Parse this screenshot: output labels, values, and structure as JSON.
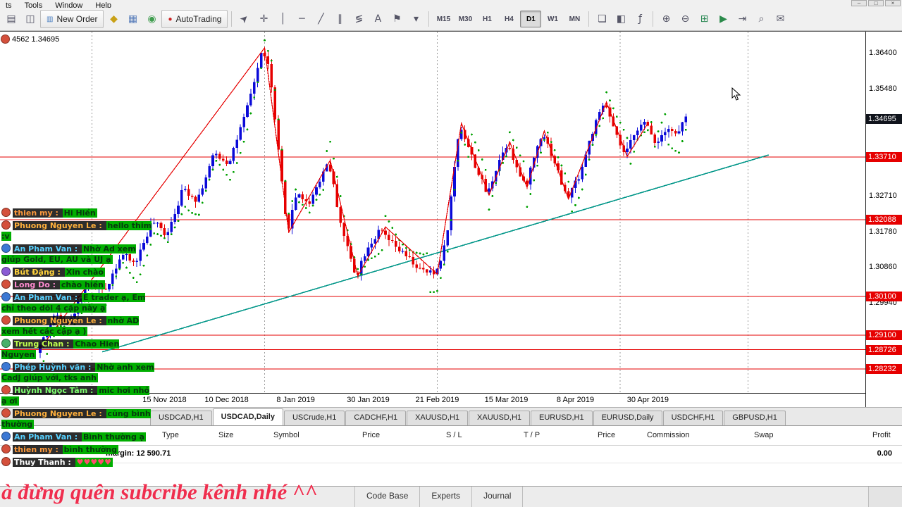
{
  "window": {
    "menu_items": [
      "ts",
      "Tools",
      "Window",
      "Help"
    ],
    "window_controls": [
      {
        "name": "minimize-button",
        "glyph": "–"
      },
      {
        "name": "restore-button",
        "glyph": "□"
      },
      {
        "name": "close-button",
        "glyph": "×"
      }
    ]
  },
  "toolbar": {
    "items": [
      {
        "type": "icon",
        "name": "new-chart-icon",
        "glyph": "▤"
      },
      {
        "type": "icon",
        "name": "profiles-icon",
        "glyph": "◫"
      },
      {
        "type": "button",
        "name": "new-order-button",
        "label": "New Order",
        "glyph": "▥",
        "glyph_color": "#4a7fc1"
      },
      {
        "type": "icon",
        "name": "expert-advisors-icon",
        "glyph": "◆",
        "color": "#c9a117"
      },
      {
        "type": "icon",
        "name": "print-icon",
        "glyph": "▦",
        "color": "#5b7fbb"
      },
      {
        "type": "icon",
        "name": "data-window-icon",
        "glyph": "◉",
        "color": "#3f9d4e"
      },
      {
        "type": "button",
        "name": "autotrading-button",
        "label": "AutoTrading",
        "glyph": "●",
        "glyph_color": "#cc2222"
      },
      {
        "type": "sep"
      },
      {
        "type": "icon",
        "name": "cursor-icon",
        "glyph": "➤",
        "rot": -45
      },
      {
        "type": "icon",
        "name": "crosshair-icon",
        "glyph": "✛"
      },
      {
        "type": "icon",
        "name": "vertical-line-icon",
        "glyph": "│"
      },
      {
        "type": "icon",
        "name": "horizontal-line-icon",
        "glyph": "─"
      },
      {
        "type": "icon",
        "name": "trendline-icon",
        "glyph": "╱"
      },
      {
        "type": "icon",
        "name": "channel-icon",
        "glyph": "∥"
      },
      {
        "type": "icon",
        "name": "fibonacci-icon",
        "glyph": "≶"
      },
      {
        "type": "icon",
        "name": "text-icon",
        "glyph": "A"
      },
      {
        "type": "icon",
        "name": "arrow-label-icon",
        "glyph": "⚑"
      },
      {
        "type": "icon",
        "name": "shapes-dropdown-icon",
        "glyph": "▾"
      },
      {
        "type": "sep"
      },
      {
        "type": "tf",
        "name": "timeframe-m15",
        "label": "M15"
      },
      {
        "type": "tf",
        "name": "timeframe-m30",
        "label": "M30"
      },
      {
        "type": "tf",
        "name": "timeframe-h1",
        "label": "H1"
      },
      {
        "type": "tf",
        "name": "timeframe-h4",
        "label": "H4"
      },
      {
        "type": "tf",
        "name": "timeframe-d1",
        "label": "D1",
        "active": true
      },
      {
        "type": "tf",
        "name": "timeframe-w1",
        "label": "W1"
      },
      {
        "type": "tf",
        "name": "timeframe-mn",
        "label": "MN"
      },
      {
        "type": "sep"
      },
      {
        "type": "icon",
        "name": "cascade-windows-icon",
        "glyph": "❏"
      },
      {
        "type": "icon",
        "name": "tile-horizontally-icon",
        "glyph": "◧"
      },
      {
        "type": "icon",
        "name": "indicators-icon",
        "glyph": "ƒ"
      },
      {
        "type": "sep"
      },
      {
        "type": "icon",
        "name": "zoom-in-icon",
        "glyph": "⊕"
      },
      {
        "type": "icon",
        "name": "zoom-out-icon",
        "glyph": "⊖"
      },
      {
        "type": "icon",
        "name": "tile-windows-icon",
        "glyph": "⊞",
        "color": "#2e8b57"
      },
      {
        "type": "icon",
        "name": "strategy-tester-icon",
        "glyph": "▶",
        "color": "#2a8a4a"
      },
      {
        "type": "icon",
        "name": "chart-shift-icon",
        "glyph": "⇥"
      },
      {
        "type": "icon",
        "name": "search-icon",
        "glyph": "⌕"
      },
      {
        "type": "icon",
        "name": "chat-icon",
        "glyph": "✉"
      }
    ]
  },
  "chart": {
    "info_text": "4562 1.34695"
  },
  "chart_data": {
    "type": "candlestick",
    "symbol": "USDCAD,Daily",
    "current_price": 1.34695,
    "price_range": {
      "top": 1.36946,
      "bottom": 1.27609
    },
    "y_axis_labels": [
      1.364,
      1.3548,
      1.3271,
      1.3178,
      1.3086,
      1.2994
    ],
    "price_line_levels": [
      1.3371,
      1.32088,
      1.301,
      1.291,
      1.28726,
      1.28232
    ],
    "x_axis_labels": [
      {
        "label": "15 Nov 2018",
        "i": 36
      },
      {
        "label": "10 Dec 2018",
        "i": 54
      },
      {
        "label": "8 Jan 2019",
        "i": 74
      },
      {
        "label": "30 Jan 2019",
        "i": 95
      },
      {
        "label": "21 Feb 2019",
        "i": 115
      },
      {
        "label": "15 Mar 2019",
        "i": 135
      },
      {
        "label": "8 Apr 2019",
        "i": 155
      },
      {
        "label": "30 Apr 2019",
        "i": 176
      }
    ],
    "separators_i": [
      15,
      65,
      115,
      168,
      205
    ],
    "candle_count": 188,
    "price_path": [
      [
        0,
        1.2875
      ],
      [
        5,
        1.2965
      ],
      [
        9,
        1.294
      ],
      [
        14,
        1.3045
      ],
      [
        19,
        1.302
      ],
      [
        24,
        1.312
      ],
      [
        28,
        1.3095
      ],
      [
        33,
        1.3205
      ],
      [
        37,
        1.317
      ],
      [
        42,
        1.329
      ],
      [
        46,
        1.326
      ],
      [
        51,
        1.338
      ],
      [
        55,
        1.3355
      ],
      [
        60,
        1.348
      ],
      [
        65,
        1.3653
      ],
      [
        67,
        1.359
      ],
      [
        72,
        1.3176
      ],
      [
        75,
        1.3285
      ],
      [
        78,
        1.3245
      ],
      [
        84,
        1.3362
      ],
      [
        88,
        1.318
      ],
      [
        92,
        1.3063
      ],
      [
        95,
        1.3135
      ],
      [
        99,
        1.318
      ],
      [
        103,
        1.314
      ],
      [
        107,
        1.311
      ],
      [
        111,
        1.3075
      ],
      [
        115,
        1.3068
      ],
      [
        118,
        1.315
      ],
      [
        122,
        1.3458
      ],
      [
        126,
        1.336
      ],
      [
        130,
        1.3272
      ],
      [
        133,
        1.3355
      ],
      [
        136,
        1.341
      ],
      [
        139,
        1.333
      ],
      [
        141,
        1.3292
      ],
      [
        144,
        1.3385
      ],
      [
        146,
        1.3438
      ],
      [
        150,
        1.3345
      ],
      [
        153,
        1.3262
      ],
      [
        157,
        1.333
      ],
      [
        160,
        1.3425
      ],
      [
        164,
        1.3513
      ],
      [
        167,
        1.343
      ],
      [
        170,
        1.3372
      ],
      [
        173,
        1.3445
      ],
      [
        176,
        1.3458
      ],
      [
        179,
        1.3405
      ],
      [
        182,
        1.3452
      ],
      [
        185,
        1.3425
      ],
      [
        187,
        1.347
      ]
    ],
    "zigzag": [
      [
        0,
        1.2875
      ],
      [
        65,
        1.3653
      ],
      [
        72,
        1.3176
      ],
      [
        84,
        1.3362
      ],
      [
        92,
        1.3063
      ],
      [
        100,
        1.319
      ],
      [
        115,
        1.3068
      ],
      [
        122,
        1.3458
      ],
      [
        130,
        1.3272
      ],
      [
        136,
        1.341
      ],
      [
        141,
        1.3292
      ],
      [
        146,
        1.3438
      ],
      [
        153,
        1.3262
      ],
      [
        164,
        1.3513
      ],
      [
        170,
        1.3372
      ],
      [
        176,
        1.3458
      ]
    ],
    "trendline": {
      "from": [
        18,
        1.2867
      ],
      "to": [
        211,
        1.3376
      ]
    },
    "colors": {
      "up": "#0a0ad8",
      "down": "#e60000",
      "sar": "#00a000",
      "zigzag": "#e60000",
      "level_line": "#e60000",
      "current_badge": "#10141c",
      "level_badge": "#e60000"
    }
  },
  "chat": {
    "messages": [
      {
        "name": "thien my",
        "text": "Hi Hiền",
        "name_color": "#ff9a3c",
        "avatar_color": "#d4503c"
      },
      {
        "name": "Phuong Nguyen Le",
        "text": "hello thim :v",
        "name_color": "#ffb03c",
        "avatar_color": "#d4503c"
      },
      {
        "name": "An Pham Van",
        "text": "Nhờ Ad xem giúp Gold, EU, AU và UJ ạ",
        "name_color": "#58d1ff",
        "avatar_color": "#3c78d4"
      },
      {
        "name": "Bút Đặng",
        "text": "Xin chào",
        "name_color": "#ffd23c",
        "avatar_color": "#8a5ad4"
      },
      {
        "name": "Long Do",
        "text": "chào hiền",
        "name_color": "#ff8bd1",
        "avatar_color": "#d4503c"
      },
      {
        "name": "An Pham Van",
        "text": "E trader ạ, Em chỉ theo dõi 4 cặp này ạ",
        "name_color": "#58d1ff",
        "avatar_color": "#3c78d4"
      },
      {
        "name": "Phuong Nguyen Le",
        "text": "nhờ AD xem hết các cặp ạ )",
        "name_color": "#ffb03c",
        "avatar_color": "#d4503c"
      },
      {
        "name": "Trung Chan",
        "text": "Chao Hien Nguyen",
        "name_color": "#c0ff4d",
        "avatar_color": "#47b06a"
      },
      {
        "name": "Phép Huỳnh văn",
        "text": "Nhờ anh xem CadJ giúp với, tks anh",
        "name_color": "#58d1ff",
        "avatar_color": "#3c78d4"
      },
      {
        "name": "Huỳnh Ngọc Tâm",
        "text": "mic hơi nhỏ ạ ơi",
        "name_color": "#7dff6e",
        "avatar_color": "#d4503c"
      },
      {
        "name": "Phuong Nguyen Le",
        "text": "cũng bình thường",
        "name_color": "#ffb03c",
        "avatar_color": "#d4503c"
      },
      {
        "name": "An Pham Van",
        "text": "Bình thường ạ",
        "name_color": "#58d1ff",
        "avatar_color": "#3c78d4"
      },
      {
        "name": "thien my",
        "text": "bình thường",
        "name_color": "#ff9a3c",
        "avatar_color": "#d4503c"
      },
      {
        "name": "Thuy Thanh",
        "text": "♥♥♥♥♥",
        "name_color": "#ffffff",
        "avatar_color": "#d4503c",
        "text_color": "#ff4d6d"
      }
    ]
  },
  "chart_tabs": {
    "active": "USDCAD,Daily",
    "items": [
      "USDCAD,H1",
      "USDCAD,Daily",
      "USCrude,H1",
      "CADCHF,H1",
      "XAUUSD,H1",
      "XAUUSD,H1",
      "EURUSD,H1",
      "EURUSD,Daily",
      "USDCHF,H1",
      "GBPUSD,H1"
    ]
  },
  "terminal": {
    "columns": [
      "Type",
      "Size",
      "Symbol",
      "Price",
      "S / L",
      "T / P",
      "Price",
      "Commission",
      "Swap",
      "Profit"
    ],
    "balance_text": "margin: 12 590.71",
    "profit_total": "0.00"
  },
  "bottom_tabs": {
    "items": [
      "Code Base",
      "Experts",
      "Journal"
    ]
  },
  "overlay": {
    "subscribe_text": "à đừng quên subcribe kênh nhé ^^"
  }
}
